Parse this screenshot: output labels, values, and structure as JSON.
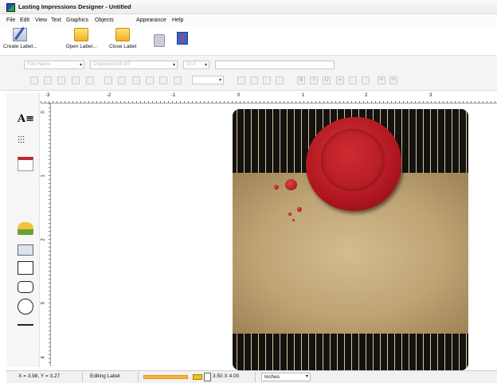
{
  "window": {
    "title": "Lasting Impressions Designer - Untitled"
  },
  "menu": [
    "File",
    "Edit",
    "View",
    "Text",
    "Graphics",
    "Objects",
    "Appearance",
    "Help"
  ],
  "ribbon": {
    "create_label": "Create Label...",
    "open_label": "Open Label...",
    "close_label": "Close Label"
  },
  "format_toolbar": {
    "font_name_placeholder": "Font Name",
    "font_family": "CopperplGoth BT",
    "font_size": "10.0",
    "dropdown_arrow": "▾",
    "alignment_icons": [
      "align-left-icon",
      "align-center-icon",
      "align-right-icon",
      "align-top-icon",
      "align-bottom-icon"
    ],
    "edit_icons": [
      "cut-icon",
      "copy-icon",
      "paste-icon",
      "undo-icon",
      "redo-icon"
    ]
  },
  "rulers": {
    "horizontal": [
      "-3",
      "-2",
      "-1",
      "0",
      "1",
      "2",
      "3"
    ],
    "vertical": [
      "0",
      "1",
      "2",
      "3",
      "4"
    ]
  },
  "tools": [
    "text-tool-icon",
    "bottles-tool-icon",
    "calendar-tool-icon",
    "image-tool-icon",
    "camera-tool-icon",
    "rectangle-tool-icon",
    "rounded-rectangle-tool-icon",
    "ellipse-tool-icon",
    "line-tool-icon"
  ],
  "label_design": {
    "background": "parchment with black striped bands",
    "seal_color": "#b51d25"
  },
  "status": {
    "coords": "X = 3.98, Y = 3.27",
    "mode": "Editing Label",
    "progress_fraction": 1.0,
    "label_size": "3.50 X 4.00",
    "units": "Inches"
  },
  "colors": {
    "progress": "#f4b33d",
    "titlebar_logo_blue": "#1a4fbf",
    "titlebar_logo_green": "#2aa83a"
  }
}
